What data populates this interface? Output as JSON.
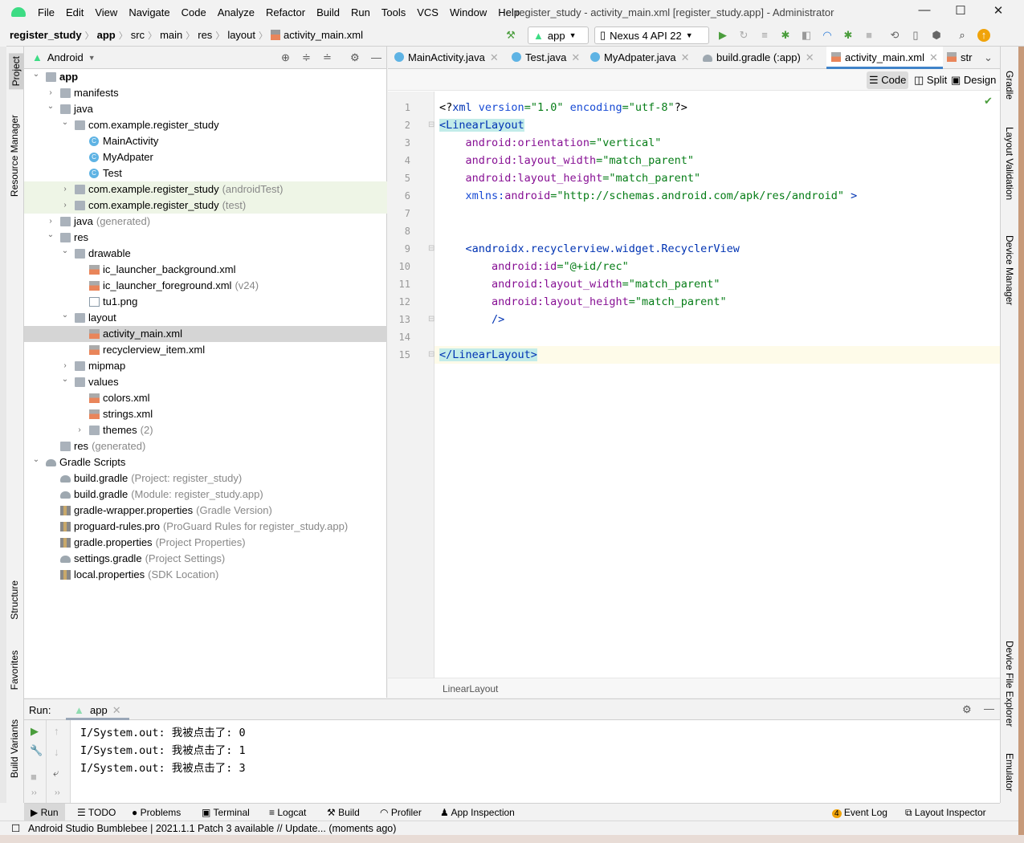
{
  "window": {
    "title": "register_study - activity_main.xml [register_study.app] - Administrator"
  },
  "menu": [
    "File",
    "Edit",
    "View",
    "Navigate",
    "Code",
    "Analyze",
    "Refactor",
    "Build",
    "Run",
    "Tools",
    "VCS",
    "Window",
    "Help"
  ],
  "breadcrumb": [
    "register_study",
    "app",
    "src",
    "main",
    "res",
    "layout",
    "activity_main.xml"
  ],
  "toolbar": {
    "config": "app",
    "device": "Nexus 4 API 22"
  },
  "left_stripe": [
    "Project",
    "Resource Manager",
    "Structure",
    "Favorites",
    "Build Variants"
  ],
  "right_stripe": [
    "Gradle",
    "Layout Validation",
    "Device Manager",
    "Device File Explorer",
    "Emulator"
  ],
  "project": {
    "view": "Android",
    "tree": [
      {
        "level": 0,
        "arrow": "down",
        "icon": "folder",
        "name": "app",
        "bold": true
      },
      {
        "level": 1,
        "arrow": "right",
        "icon": "folder",
        "name": "manifests"
      },
      {
        "level": 1,
        "arrow": "down",
        "icon": "folder",
        "name": "java"
      },
      {
        "level": 2,
        "arrow": "down",
        "icon": "folder",
        "name": "com.example.register_study"
      },
      {
        "level": 3,
        "icon": "class",
        "name": "MainActivity"
      },
      {
        "level": 3,
        "icon": "class",
        "name": "MyAdpater"
      },
      {
        "level": 3,
        "icon": "class",
        "name": "Test"
      },
      {
        "level": 2,
        "arrow": "right",
        "icon": "folder",
        "name": "com.example.register_study",
        "suffix": "(androidTest)",
        "green": true
      },
      {
        "level": 2,
        "arrow": "right",
        "icon": "folder",
        "name": "com.example.register_study",
        "suffix": "(test)",
        "green": true
      },
      {
        "level": 1,
        "arrow": "right",
        "icon": "folder",
        "name": "java",
        "suffix": "(generated)"
      },
      {
        "level": 1,
        "arrow": "down",
        "icon": "folder",
        "name": "res"
      },
      {
        "level": 2,
        "arrow": "down",
        "icon": "folder",
        "name": "drawable"
      },
      {
        "level": 3,
        "icon": "xml",
        "name": "ic_launcher_background.xml"
      },
      {
        "level": 3,
        "icon": "xml",
        "name": "ic_launcher_foreground.xml",
        "suffix": "(v24)"
      },
      {
        "level": 3,
        "icon": "png",
        "name": "tu1.png"
      },
      {
        "level": 2,
        "arrow": "down",
        "icon": "folder",
        "name": "layout"
      },
      {
        "level": 3,
        "icon": "xml",
        "name": "activity_main.xml",
        "selected": true
      },
      {
        "level": 3,
        "icon": "xml",
        "name": "recyclerview_item.xml"
      },
      {
        "level": 2,
        "arrow": "right",
        "icon": "folder",
        "name": "mipmap"
      },
      {
        "level": 2,
        "arrow": "down",
        "icon": "folder",
        "name": "values"
      },
      {
        "level": 3,
        "icon": "xml",
        "name": "colors.xml"
      },
      {
        "level": 3,
        "icon": "xml",
        "name": "strings.xml"
      },
      {
        "level": 3,
        "arrow": "right",
        "icon": "folder",
        "name": "themes",
        "suffix": "(2)"
      },
      {
        "level": 1,
        "icon": "folder",
        "name": "res",
        "suffix": "(generated)"
      },
      {
        "level": 0,
        "arrow": "down",
        "icon": "gradle",
        "name": "Gradle Scripts"
      },
      {
        "level": 1,
        "icon": "gradle",
        "name": "build.gradle",
        "suffix": "(Project: register_study)"
      },
      {
        "level": 1,
        "icon": "gradle",
        "name": "build.gradle",
        "suffix": "(Module: register_study.app)"
      },
      {
        "level": 1,
        "icon": "props",
        "name": "gradle-wrapper.properties",
        "suffix": "(Gradle Version)"
      },
      {
        "level": 1,
        "icon": "props",
        "name": "proguard-rules.pro",
        "suffix": "(ProGuard Rules for register_study.app)"
      },
      {
        "level": 1,
        "icon": "props",
        "name": "gradle.properties",
        "suffix": "(Project Properties)"
      },
      {
        "level": 1,
        "icon": "gradle",
        "name": "settings.gradle",
        "suffix": "(Project Settings)"
      },
      {
        "level": 1,
        "icon": "props",
        "name": "local.properties",
        "suffix": "(SDK Location)"
      }
    ]
  },
  "editor": {
    "tabs": [
      {
        "label": "MainActivity.java",
        "icon": "class"
      },
      {
        "label": "Test.java",
        "icon": "class"
      },
      {
        "label": "MyAdpater.java",
        "icon": "class"
      },
      {
        "label": "build.gradle (:app)",
        "icon": "gradle"
      },
      {
        "label": "activity_main.xml",
        "icon": "xml",
        "active": true
      },
      {
        "label": "str",
        "icon": "xml"
      }
    ],
    "modes": [
      "Code",
      "Split",
      "Design"
    ],
    "active_mode": "Code",
    "lines": [
      [
        [
          "t-plain",
          "<?"
        ],
        [
          "t-tag",
          "xml "
        ],
        [
          "t-ns",
          "version"
        ],
        [
          "t-val",
          "=\"1.0\" "
        ],
        [
          "t-ns",
          "encoding"
        ],
        [
          "t-val",
          "=\"utf-8\""
        ],
        [
          "t-plain",
          "?>"
        ]
      ],
      [
        [
          "t-tag hl",
          "<LinearLayout"
        ]
      ],
      [
        [
          "t-plain",
          "    "
        ],
        [
          "t-attr",
          "android:orientation"
        ],
        [
          "t-val",
          "=\"vertical\""
        ]
      ],
      [
        [
          "t-plain",
          "    "
        ],
        [
          "t-attr",
          "android:layout_width"
        ],
        [
          "t-val",
          "=\"match_parent\""
        ]
      ],
      [
        [
          "t-plain",
          "    "
        ],
        [
          "t-attr",
          "android:layout_height"
        ],
        [
          "t-val",
          "=\"match_parent\""
        ]
      ],
      [
        [
          "t-plain",
          "    "
        ],
        [
          "t-ns",
          "xmlns:"
        ],
        [
          "t-attr",
          "android"
        ],
        [
          "t-val",
          "=\"http://schemas.android.com/apk/res/android\""
        ],
        [
          "t-tag",
          " >"
        ]
      ],
      [],
      [],
      [
        [
          "t-plain",
          "    "
        ],
        [
          "t-tag",
          "<androidx.recyclerview.widget.RecyclerView"
        ]
      ],
      [
        [
          "t-plain",
          "        "
        ],
        [
          "t-attr",
          "android:id"
        ],
        [
          "t-val",
          "=\"@+id/rec\""
        ]
      ],
      [
        [
          "t-plain",
          "        "
        ],
        [
          "t-attr",
          "android:layout_width"
        ],
        [
          "t-val",
          "=\"match_parent\""
        ]
      ],
      [
        [
          "t-plain",
          "        "
        ],
        [
          "t-attr",
          "android:layout_height"
        ],
        [
          "t-val",
          "=\"match_parent\""
        ]
      ],
      [
        [
          "t-plain",
          "        "
        ],
        [
          "t-tag",
          "/>"
        ]
      ],
      [],
      [
        [
          "t-tag hl",
          "</LinearLayout>"
        ]
      ]
    ],
    "current_line": 15,
    "breadcrumb": "LinearLayout"
  },
  "run": {
    "label": "Run:",
    "tab": "app",
    "output": [
      "I/System.out: 我被点击了: 0",
      "I/System.out: 我被点击了: 1",
      "I/System.out: 我被点击了: 3"
    ]
  },
  "tool_tabs": [
    "Run",
    "TODO",
    "Problems",
    "Terminal",
    "Logcat",
    "Build",
    "Profiler",
    "App Inspection"
  ],
  "tool_tabs_right": {
    "event_log_count": "4",
    "event_log": "Event Log",
    "layout_inspector": "Layout Inspector"
  },
  "status": "Android Studio Bumblebee | 2021.1.1 Patch 3 available // Update... (moments ago)",
  "colors": {
    "android_green": "#3ddc84",
    "tab_underline": "#4083c9",
    "tag": "#0033b3",
    "attr": "#871094",
    "value": "#067d17"
  }
}
